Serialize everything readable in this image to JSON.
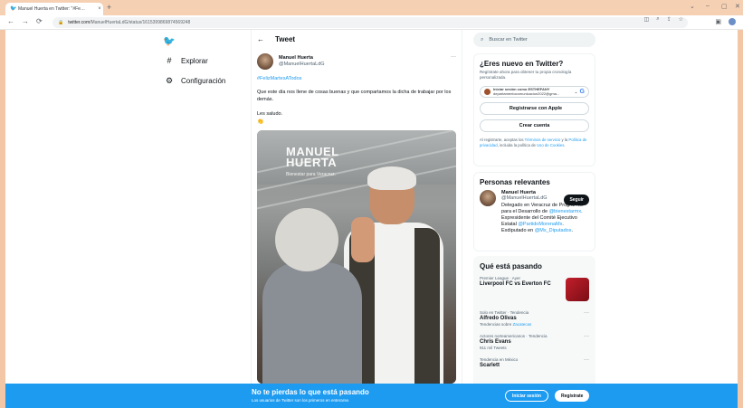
{
  "browser": {
    "tab_title": "Manuel Huerta en Twitter: \"#Fe…",
    "tab_close": "×",
    "new_tab": "+",
    "url_host": "twitter.com",
    "url_path": "/ManuelHuertaLdG/status/1615399869874569248",
    "window_controls": [
      "⌄",
      "–",
      "▢",
      "✕"
    ]
  },
  "leftnav": {
    "items": [
      {
        "icon": "#",
        "label": "Explorar"
      },
      {
        "icon": "⚙",
        "label": "Configuración"
      }
    ]
  },
  "tweet": {
    "header": "Tweet",
    "author_name": "Manuel Huerta",
    "author_handle": "@ManuelHuertaLdG",
    "hashtag": "#FelizMartesATodos",
    "text": "Que este día nos llene de cosas buenas y que compartamos la dicha de trabajar por los demás.",
    "greeting": "Les saludo.",
    "photo_brand": "MANUEL HUERTA",
    "photo_brand_sub": "Bienestar para Veracruz."
  },
  "search": {
    "placeholder": "Buscar en Twitter"
  },
  "signup": {
    "title": "¿Eres nuevo en Twitter?",
    "subtitle": "Regístrate ahora para obtener tu propia cronología personalizada.",
    "google_line1": "Iniciar sesión como ESTHEFANY",
    "google_line2": "departamentocomunicacion2022@gma...",
    "apple_label": "Registrarse con Apple",
    "create_label": "Crear cuenta",
    "legal_pre": "Al registrarte, aceptas los ",
    "legal_terms": "Términos de servicio",
    "legal_mid": " y la ",
    "legal_privacy": "Política de privacidad",
    "legal_mid2": ", incluida la política de ",
    "legal_cookies": "Uso de Cookies",
    "legal_end": "."
  },
  "relevant": {
    "title": "Personas relevantes",
    "name": "Manuel Huerta",
    "handle": "@ManuelHuertaLdG",
    "follow": "Seguir",
    "bio_1": "Delegado en Veracruz de Programas para el Desarrollo de ",
    "bio_link1": "@bienestarmx",
    "bio_2": ". Expresidente del Comité Ejecutivo Estatal ",
    "bio_link2": "@PartidoMorenaMx",
    "bio_3": ". Exdiputado en ",
    "bio_link3": "@Mx_Diputados",
    "bio_4": "."
  },
  "trends": {
    "title": "Qué está pasando",
    "items": [
      {
        "meta": "Premier League · Ayer",
        "title": "Liverpool FC vs Everton FC",
        "sub": "",
        "sub_link": ""
      },
      {
        "meta": "Solo en Twitter · Tendencia",
        "title": "Alfredo Olivas",
        "sub": "Tendencias sobre ",
        "sub_link": "Zacatecas"
      },
      {
        "meta": "Actores norteamericanos · Tendencia",
        "title": "Chris Evans",
        "sub": "911 mil Tweets",
        "sub_link": ""
      },
      {
        "meta": "Tendencia en México",
        "title": "Scarlett",
        "sub": "",
        "sub_link": ""
      }
    ]
  },
  "banner": {
    "title": "No te pierdas lo que está pasando",
    "subtitle": "Los usuarios de Twitter son los primeros en enterarse.",
    "login": "Iniciar sesión",
    "signup": "Regístrate"
  },
  "colors": {
    "brand": "#1d9bf0",
    "frame": "#f3c6a6"
  }
}
